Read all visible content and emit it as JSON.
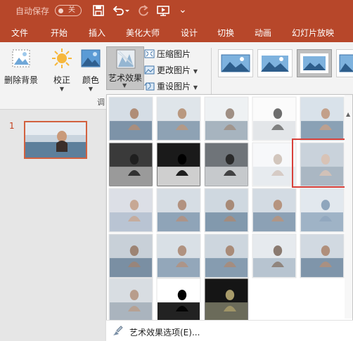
{
  "titlebar": {
    "autosave_label": "自动保存",
    "autosave_state": "关",
    "qat_more": "⌄"
  },
  "tabs": [
    "文件",
    "开始",
    "插入",
    "美化大师",
    "设计",
    "切换",
    "动画",
    "幻灯片放映"
  ],
  "ribbon": {
    "remove_bg": "删除背景",
    "corrections": "校正",
    "color": "颜色",
    "artistic_effects": "艺术效果",
    "compress": "压缩图片",
    "change": "更改图片",
    "reset": "重设图片",
    "group_label_partial": "调"
  },
  "slides": {
    "current_number": "1"
  },
  "gallery": {
    "footer_label": "艺术效果选项(E)...",
    "rows": 5,
    "columns": 5,
    "selected_effect_index": 9
  },
  "colors": {
    "brand": "#b7472a",
    "selection": "#d8403a",
    "slide_selection": "#d2613f"
  }
}
